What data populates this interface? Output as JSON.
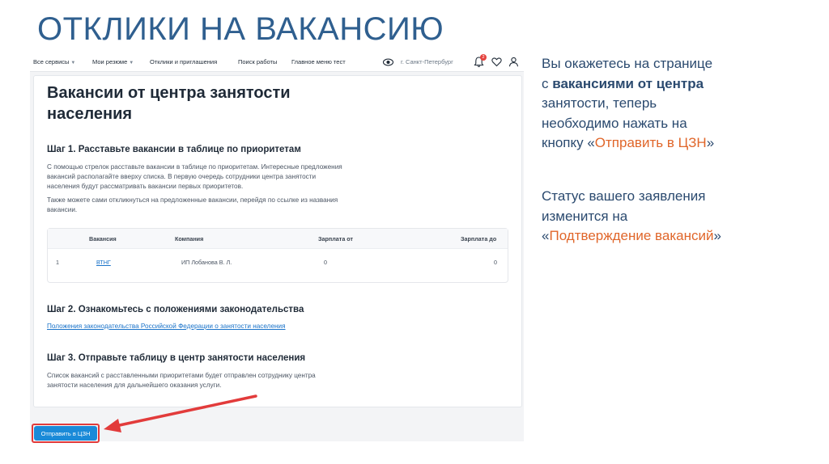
{
  "slide": {
    "title": "ОТКЛИКИ НА ВАКАНСИЮ"
  },
  "topnav": {
    "items": [
      "Все сервисы",
      "Мои резюме",
      "Отклики и приглашения",
      "Поиск работы",
      "Главное меню тест"
    ],
    "city": "г. Санкт-Петербург",
    "notification_count": "2"
  },
  "page": {
    "heading_line1": "Вакансии от центра занятости",
    "heading_line2": "населения",
    "step1": {
      "title": "Шаг 1. Расставьте вакансии в таблице по приоритетам",
      "text1_l1": "С помощью стрелок расставьте вакансии в таблице по приоритетам. Интересные предложения",
      "text1_l2": "вакансий располагайте вверху списка. В первую очередь сотрудники центра занятости",
      "text1_l3": "населения будут рассматривать вакансии первых приоритетов.",
      "text2_l1": "Также можете сами откликнуться на предложенные вакансии, перейдя по ссылке из названия",
      "text2_l2": "вакансии."
    },
    "table": {
      "headers": [
        "Вакансия",
        "Компания",
        "Зарплата от",
        "Зарплата до"
      ],
      "rows": [
        {
          "num": "1",
          "vacancy": "ВТНГ",
          "company": "ИП Лобанова В. Л.",
          "salary_from": "0",
          "salary_to": "0"
        }
      ]
    },
    "step2": {
      "title": "Шаг 2. Ознакомьтесь с положениями законодательства",
      "link": "Положения законодательства Российской Федерации о занятости населения"
    },
    "step3": {
      "title": "Шаг 3. Отправьте таблицу в центр занятости населения",
      "text_l1": "Список вакансий с расставленными приоритетами будет отправлен сотруднику центра",
      "text_l2": "занятости населения для дальнейшего оказания услуги."
    },
    "send_button": "Отправить в ЦЗН"
  },
  "explanation": {
    "p1_l1": "Вы окажетесь на странице",
    "p1_l2a": "с ",
    "p1_l2b": "вакансиями от центра",
    "p1_l3": "занятости, теперь",
    "p1_l4": "необходимо нажать на",
    "p1_l5a": "кнопку «",
    "p1_l5b": "Отправить в ЦЗН",
    "p1_l5c": "»",
    "p2_l1": "Статус вашего заявления",
    "p2_l2": "изменится на",
    "p2_l3a": "«",
    "p2_l3b": "Подтверждение вакансий",
    "p2_l3c": "»"
  },
  "colors": {
    "title": "#2f5f8f",
    "accent": "#e0662a",
    "highlight": "#e23b3b",
    "button": "#1a8ad8",
    "link": "#1a73c9"
  }
}
